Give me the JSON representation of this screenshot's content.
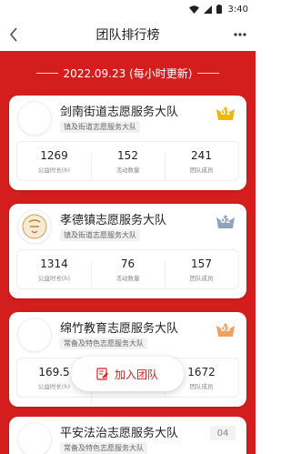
{
  "status_bar": {
    "time": "3:40"
  },
  "nav": {
    "title": "团队排行榜"
  },
  "header": {
    "date_text": "2022.09.23 (每小时更新)"
  },
  "stat_labels": {
    "hours": "公益时长(h)",
    "activities": "活动数量",
    "members": "团队成员"
  },
  "teams": [
    {
      "name": "剑南街道志愿服务大队",
      "tag": "镇及街道志愿服务大队",
      "rank": "01",
      "rank_color": "#f5b400",
      "hours": "1269",
      "activities": "152",
      "members": "241"
    },
    {
      "name": "孝德镇志愿服务大队",
      "tag": "镇及街道志愿服务大队",
      "rank": "02",
      "rank_color": "#8fa3bf",
      "hours": "1314",
      "activities": "76",
      "members": "157"
    },
    {
      "name": "绵竹教育志愿服务大队",
      "tag": "常备及特色志愿服务大队",
      "rank": "03",
      "rank_color": "#f0a060",
      "hours": "169.5",
      "activities": "",
      "members": "1672"
    },
    {
      "name": "平安法治志愿服务大队",
      "tag": "常备及特色志愿服务大队",
      "rank": "04"
    }
  ],
  "join_button": {
    "label": "加入团队"
  },
  "colors": {
    "primary_red": "#d41e1e"
  }
}
